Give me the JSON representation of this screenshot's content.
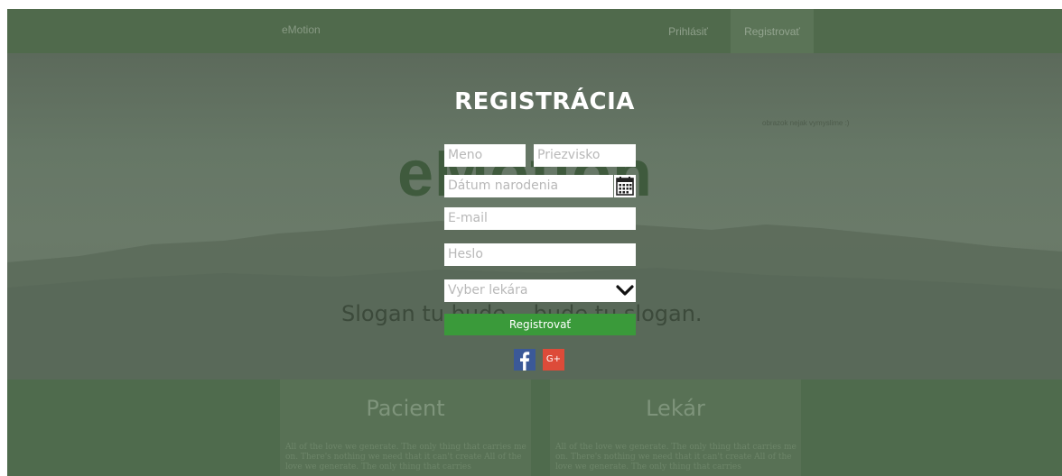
{
  "header": {
    "brand": "eMotion",
    "nav": {
      "login": "Prihlásiť",
      "register": "Registrovať"
    }
  },
  "hero": {
    "note": "obrazok nejak vymyslime :)",
    "big_logo": "eMotion",
    "slogan": "Slogan tu bude... bude tu slogan."
  },
  "form": {
    "title": "REGISTRÁCIA",
    "first_name_placeholder": "Meno",
    "last_name_placeholder": "Priezvisko",
    "birthdate_placeholder": "Dátum narodenia",
    "email_placeholder": "E-mail",
    "password_placeholder": "Heslo",
    "doctor_select": "Vyber lekára",
    "submit_label": "Registrovať",
    "google_label": "G+"
  },
  "panels": [
    {
      "title": "Pacient",
      "text": "All of the love we generate. The only thing that carries me on. There's nothing we need that it can't create All of the love we generate. The only thing that carries"
    },
    {
      "title": "Lekár",
      "text": "All of the love we generate. The only thing that carries me on. There's nothing we need that it can't create All of the love we generate. The only thing that carries"
    }
  ],
  "colors": {
    "header_bg": "#506a4c",
    "submit_bg": "#3a9a3a",
    "facebook": "#3b5998",
    "google": "#dd4b39"
  }
}
